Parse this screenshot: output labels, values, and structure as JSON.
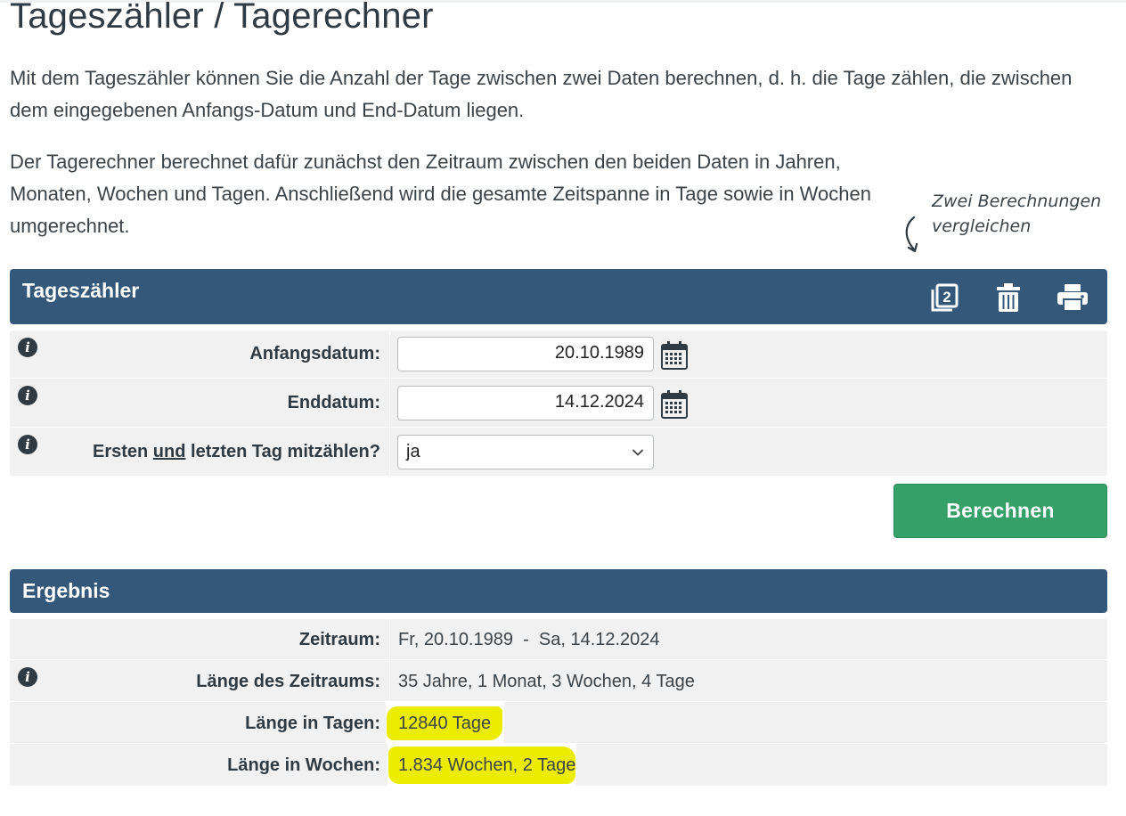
{
  "page": {
    "title": "Tageszähler / Tagerechner",
    "intro_1": "Mit dem Tageszähler können Sie die Anzahl der Tage zwischen zwei Daten berechnen, d. h. die Tage zählen, die zwischen dem eingegebenen Anfangs-Datum und End-Datum liegen.",
    "intro_2": "Der Tagerechner berechnet dafür zunächst den Zeitraum zwischen den beiden Daten in Jahren, Monaten, Wochen und Tagen. Anschließend wird die gesamte Zeitspanne in Tage sowie in Wochen umgerechnet.",
    "note_line1": "Zwei Berechnungen",
    "note_line2": "vergleichen"
  },
  "calculator": {
    "header": "Tageszähler",
    "icons": [
      "compare-icon",
      "trash-icon",
      "print-icon"
    ],
    "start_label": "Anfangsdatum:",
    "start_value": "20.10.1989",
    "end_label": "Enddatum:",
    "end_value": "14.12.2024",
    "include_label_a": "Ersten ",
    "include_label_u": "und",
    "include_label_b": " letzten Tag mitzählen?",
    "include_value": "ja",
    "button": "Berechnen"
  },
  "result": {
    "header": "Ergebnis",
    "rows": [
      {
        "label": "Zeitraum:",
        "value": "Fr, 20.10.1989  -  Sa, 14.12.2024"
      },
      {
        "label": "Länge des Zeitraums:",
        "value": "35 Jahre, 1 Monat, 3 Wochen, 4 Tage"
      },
      {
        "label": "Länge in Tagen:",
        "value": "12840 Tage"
      },
      {
        "label": "Länge in Wochen:",
        "value": "1.834 Wochen, 2 Tage"
      }
    ]
  },
  "colors": {
    "header_bar": "#34587a",
    "button": "#35a067",
    "highlight": "#ecec00",
    "table_bg": "#f1f1f1"
  }
}
